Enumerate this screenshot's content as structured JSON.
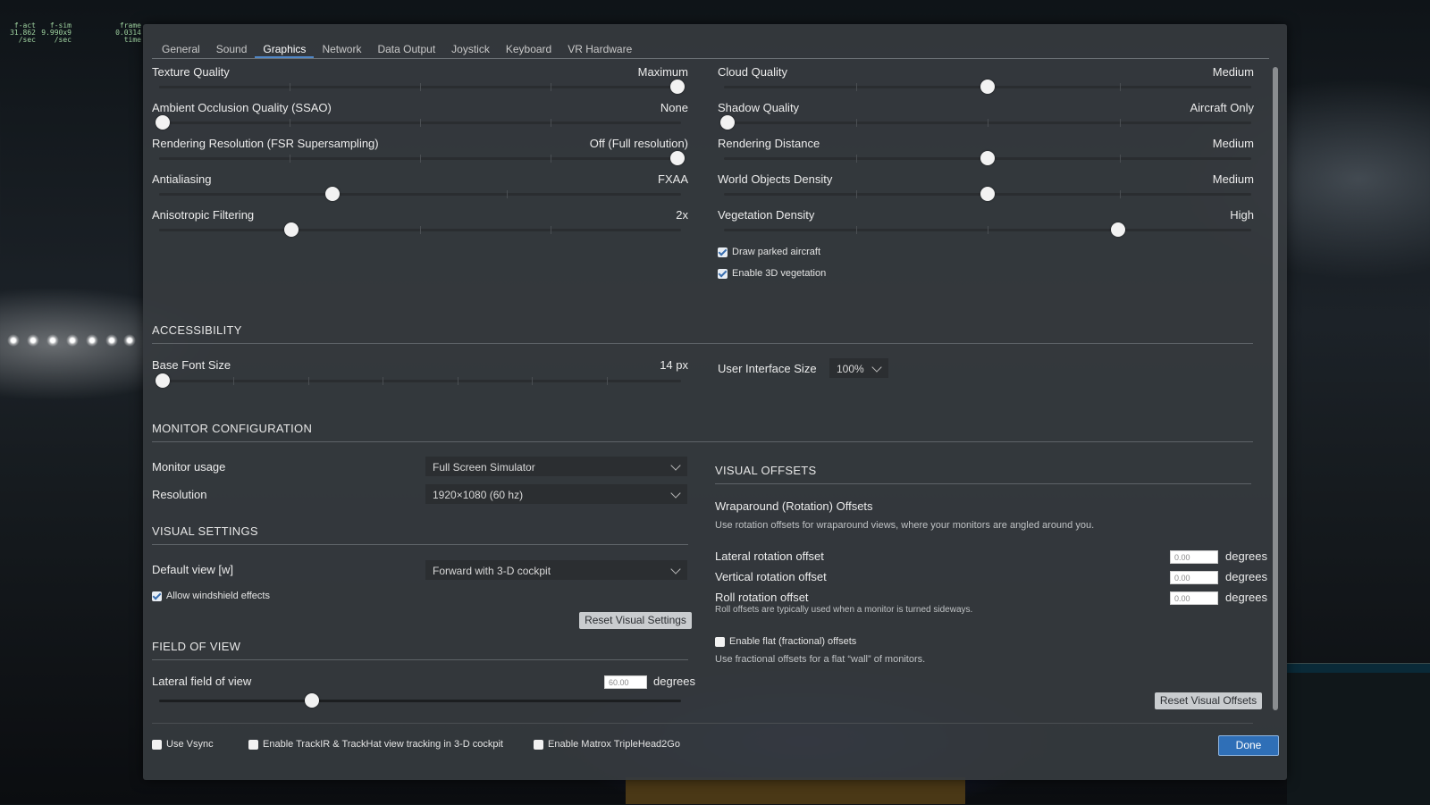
{
  "hud": {
    "col1": [
      "f-act",
      "31.862",
      "/sec"
    ],
    "col2": [
      "f-sim",
      "9.990x9",
      "/sec"
    ],
    "col3": [
      "frame",
      "0.0314",
      "time"
    ]
  },
  "tabs": [
    "General",
    "Sound",
    "Graphics",
    "Network",
    "Data Output",
    "Joystick",
    "Keyboard",
    "VR Hardware"
  ],
  "active_tab": "Graphics",
  "graphics_left": [
    {
      "label": "Texture Quality",
      "value": "Maximum",
      "level": 1.0
    },
    {
      "label": "Ambient Occlusion Quality (SSAO)",
      "value": "None",
      "level": 0.0
    },
    {
      "label": "Rendering Resolution (FSR Supersampling)",
      "value": "Off (Full resolution)",
      "level": 1.0
    },
    {
      "label": "Antialiasing",
      "value": "FXAA",
      "level": 0.33
    },
    {
      "label": "Anisotropic Filtering",
      "value": "2x",
      "level": 0.25
    }
  ],
  "graphics_right": [
    {
      "label": "Cloud Quality",
      "value": "Medium",
      "level": 0.5
    },
    {
      "label": "Shadow Quality",
      "value": "Aircraft Only",
      "level": 0.0
    },
    {
      "label": "Rendering Distance",
      "value": "Medium",
      "level": 0.5
    },
    {
      "label": "World Objects Density",
      "value": "Medium",
      "level": 0.5
    },
    {
      "label": "Vegetation Density",
      "value": "High",
      "level": 0.75
    }
  ],
  "draw_parked_aircraft": {
    "label": "Draw parked aircraft",
    "checked": true
  },
  "enable_3d_vegetation": {
    "label": "Enable 3D vegetation",
    "checked": true
  },
  "accessibility": {
    "heading": "ACCESSIBILITY",
    "base_font_label": "Base Font Size",
    "base_font_value": "14 px",
    "base_font_level": 0.0,
    "ui_size_label": "User Interface Size",
    "ui_size_value": "100%"
  },
  "monitor": {
    "heading": "MONITOR CONFIGURATION",
    "usage_label": "Monitor usage",
    "usage_value": "Full Screen Simulator",
    "resolution_label": "Resolution",
    "resolution_value": "1920×1080 (60 hz)"
  },
  "visual_settings": {
    "heading": "VISUAL SETTINGS",
    "default_view_label": "Default view [w]",
    "default_view_value": "Forward with 3-D cockpit",
    "windshield_label": "Allow windshield effects",
    "windshield_checked": true,
    "reset_button": "Reset Visual Settings"
  },
  "fov": {
    "heading": "FIELD OF VIEW",
    "lateral_label": "Lateral field of view",
    "lateral_value": "60.00",
    "unit": "degrees",
    "level": 0.29
  },
  "visual_offsets": {
    "heading": "VISUAL OFFSETS",
    "wrap_title": "Wraparound (Rotation) Offsets",
    "wrap_desc": "Use rotation offsets for wraparound views, where your monitors are angled around you.",
    "lateral_label": "Lateral rotation offset",
    "lateral_value": "0.00",
    "vertical_label": "Vertical rotation offset",
    "vertical_value": "0.00",
    "roll_label": "Roll rotation offset",
    "roll_value": "0.00",
    "unit": "degrees",
    "roll_note": "Roll offsets are typically used when a monitor is turned sideways.",
    "flat_label": "Enable flat (fractional) offsets",
    "flat_checked": false,
    "flat_desc": "Use fractional offsets for a flat “wall” of monitors.",
    "reset_button": "Reset Visual Offsets"
  },
  "bottom": {
    "vsync_label": "Use Vsync",
    "vsync_checked": false,
    "trackir_label": "Enable TrackIR & TrackHat view tracking in 3-D cockpit",
    "trackir_checked": false,
    "matrox_label": "Enable Matrox TripleHead2Go",
    "matrox_checked": false,
    "done_button": "Done"
  },
  "colors": {
    "accent": "#2f6fb7",
    "panel": "#363a3e",
    "thumb": "#f2f2f2"
  }
}
